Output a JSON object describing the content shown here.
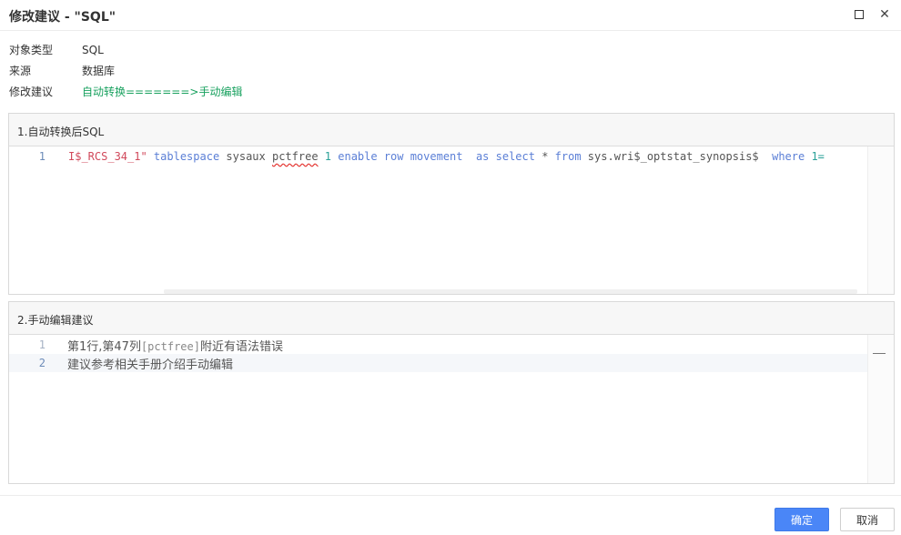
{
  "dialog": {
    "title": "修改建议 - \"SQL\"",
    "maximize_icon": "maximize-icon",
    "close_icon": "close-icon",
    "close_glyph": "✕"
  },
  "info": [
    {
      "label": "对象类型",
      "value": "SQL"
    },
    {
      "label": "来源",
      "value": "数据库"
    },
    {
      "label": "修改建议",
      "value": "自动转换=======>手动编辑"
    }
  ],
  "panel1": {
    "title": "1.自动转换后SQL",
    "line_number": "1",
    "tokens": [
      {
        "text": "I$_RCS_34_1\"",
        "kind": "str"
      },
      {
        "text": " tablespace",
        "kind": "kw"
      },
      {
        "text": " sysaux ",
        "kind": "plain"
      },
      {
        "text": "pctfree",
        "kind": "ident"
      },
      {
        "text": " 1",
        "kind": "num"
      },
      {
        "text": " enable row movement  as select",
        "kind": "kw"
      },
      {
        "text": " * ",
        "kind": "plain"
      },
      {
        "text": "from",
        "kind": "kw"
      },
      {
        "text": " sys.wri$_optstat_synopsis$  ",
        "kind": "plain"
      },
      {
        "text": "where",
        "kind": "kw"
      },
      {
        "text": " 1=",
        "kind": "num"
      }
    ]
  },
  "panel2": {
    "title": "2.手动编辑建议",
    "lines": [
      {
        "number": "1",
        "pre": "第1行,第47列",
        "code": "[pctfree]",
        "post": "附近有语法错误"
      },
      {
        "number": "2",
        "pre": "建议参考相关手册介绍手动编辑",
        "code": "",
        "post": ""
      }
    ]
  },
  "footer": {
    "confirm_label": "确定",
    "cancel_label": "取消"
  },
  "colors": {
    "accent": "#4a86f7",
    "suggestion_green": "#19a15f",
    "string_red": "#d1495b",
    "keyword_blue": "#5b7fd6"
  }
}
